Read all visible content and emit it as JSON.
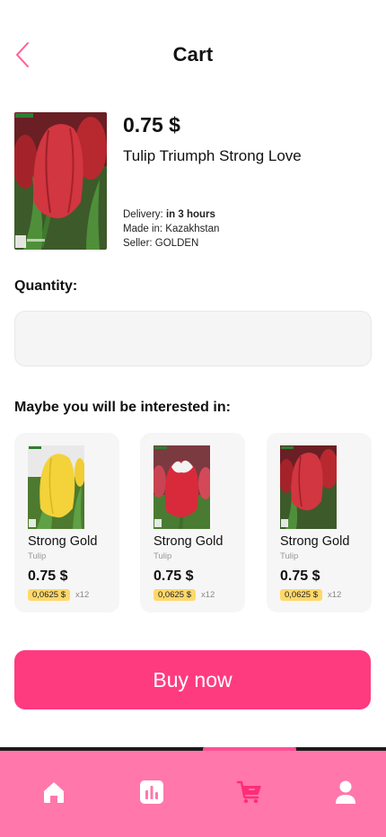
{
  "header": {
    "title": "Cart"
  },
  "product": {
    "price": "0.75 $",
    "name": "Tulip Triumph Strong Love",
    "delivery_label": "Delivery: ",
    "delivery_value": "in 3 hours",
    "made_in": "Made in: Kazakhstan",
    "seller": "Seller: GOLDEN"
  },
  "quantity": {
    "label": "Quantity:",
    "value": "",
    "placeholder": ""
  },
  "recommendations": {
    "title": "Maybe you will be interested in:",
    "items": [
      {
        "name": "Strong Gold",
        "type": "Tulip",
        "price": "0.75 $",
        "unit_price": "0,0625 $",
        "multiplier": "x12"
      },
      {
        "name": "Strong Gold",
        "type": "Tulip",
        "price": "0.75 $",
        "unit_price": "0,0625 $",
        "multiplier": "x12"
      },
      {
        "name": "Strong Gold",
        "type": "Tulip",
        "price": "0.75 $",
        "unit_price": "0,0625 $",
        "multiplier": "x12"
      }
    ]
  },
  "buy_button": {
    "label": "Buy now"
  },
  "bottom_nav": {
    "items": [
      {
        "icon": "home-icon",
        "active": false
      },
      {
        "icon": "stats-icon",
        "active": false
      },
      {
        "icon": "cart-icon",
        "active": true
      },
      {
        "icon": "profile-icon",
        "active": false
      }
    ]
  },
  "colors": {
    "accent": "#ff3b80",
    "nav_background": "#ff77ab",
    "badge": "#ffd86a",
    "back_arrow": "#ff5d98"
  }
}
